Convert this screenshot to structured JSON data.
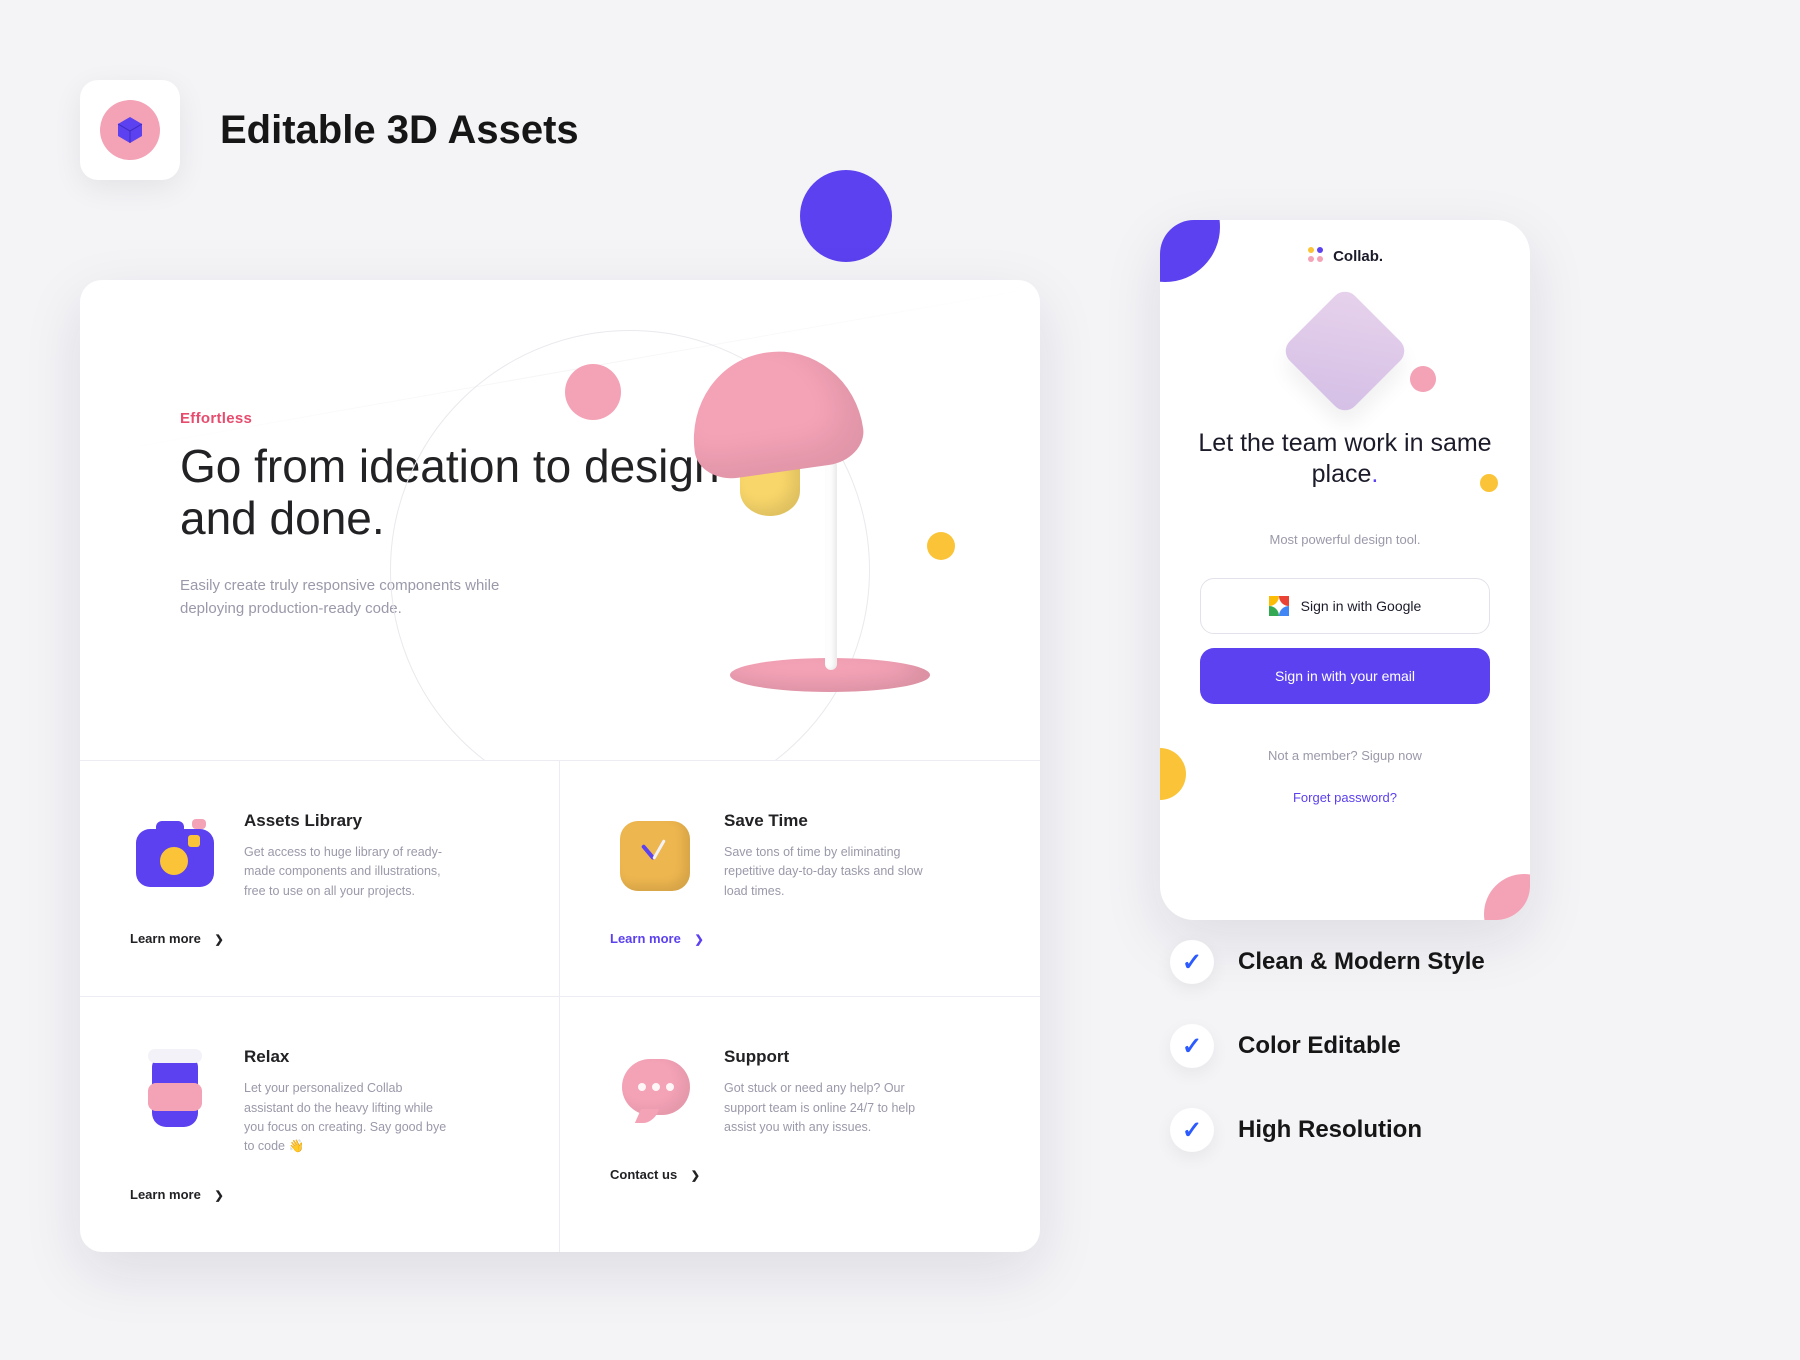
{
  "header": {
    "title": "Editable 3D Assets",
    "icon": "cube-icon"
  },
  "landing": {
    "overline": "Effortless",
    "headline": "Go from ideation to design and done.",
    "subcopy": "Easily create truly responsive components while deploying production-ready code.",
    "hero_icon": "desk-lamp-icon",
    "features": [
      {
        "icon": "camera-icon",
        "title": "Assets Library",
        "desc": "Get access to huge library of ready-made components and illustrations, free to use on all your projects.",
        "action": "Learn more"
      },
      {
        "icon": "clock-icon",
        "title": "Save Time",
        "desc": "Save tons of time by eliminating repetitive day-to-day tasks and slow load times.",
        "action": "Learn more"
      },
      {
        "icon": "coffee-cup-icon",
        "title": "Relax",
        "desc": "Let your personalized Collab assistant do the heavy lifting while you focus on creating. Say good bye to code 👋",
        "action": "Learn more"
      },
      {
        "icon": "chat-bubble-icon",
        "title": "Support",
        "desc": "Got stuck or need any help? Our support team is online 24/7 to help assist you with any issues.",
        "action": "Contact us"
      }
    ]
  },
  "mobile": {
    "brand": "Collab.",
    "hero_icon": "glass-cube-icon",
    "headline": "Let the team work in same place",
    "headline_period": ".",
    "subcopy": "Most powerful design tool.",
    "google_button": "Sign in with Google",
    "email_button": "Sign in with your email",
    "not_member": "Not a member? Sigup now",
    "forgot": "Forget password?"
  },
  "bullets": [
    "Clean & Modern Style",
    "Color Editable",
    "High Resolution"
  ],
  "colors": {
    "accent": "#5b41ef",
    "pink": "#f4a2b6",
    "yellow": "#fbc438"
  }
}
